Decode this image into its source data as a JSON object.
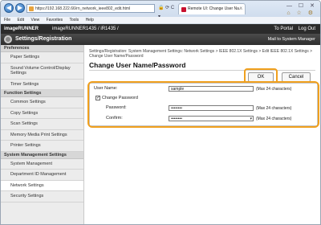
{
  "browser": {
    "back_glyph": "◀",
    "forward_glyph": "▶",
    "url": "https://192.168.222.66/rn_network_ieee802_edit.html",
    "addr_tools": "🔒 ⟳ C ▾",
    "tab_title": "Remote UI: Change User Na...",
    "tab_close": "×",
    "win_controls": "— ☐ ✕",
    "right_icons": "⌂ ☆ ⚙"
  },
  "menu": {
    "items": [
      "File",
      "Edit",
      "View",
      "Favorites",
      "Tools",
      "Help"
    ]
  },
  "header": {
    "brand": "imageRUNNER",
    "device": "imageRUNNER1435 / iR1435 /",
    "to_portal": "To Portal",
    "log_out": "Log Out",
    "section_title": "Settings/Registration",
    "mail_link": "Mail to System Manager"
  },
  "sidebar": {
    "preferences_head": "Preferences",
    "preferences": [
      "Paper Settings",
      "Sound Volume Control/Display Settings",
      "Timer Settings"
    ],
    "function_head": "Function Settings",
    "function": [
      "Common Settings",
      "Copy Settings",
      "Scan Settings",
      "Memory Media Print Settings",
      "Printer Settings"
    ],
    "system_head": "System Management Settings",
    "system": [
      "System Management",
      "Department ID Management",
      "Network Settings",
      "Security Settings"
    ]
  },
  "main": {
    "breadcrumb": "Settings/Registration: System Management Settings: Network Settings > IEEE 802.1X Settings > Edit IEEE 802.1X Settings > Change User Name/Password",
    "page_title": "Change User Name/Password",
    "ok_label": "OK",
    "cancel_label": "Cancel",
    "user_name_label": "User Name:",
    "user_name_value": "sample",
    "user_name_max": "(Max 24 characters)",
    "change_password_label": "Change Password",
    "change_password_checked": "✓",
    "password_label": "Password:",
    "password_value": "••••••••",
    "password_max": "(Max 24 characters)",
    "confirm_label": "Confirm:",
    "confirm_value": "••••••••",
    "confirm_max": "(Max 24 characters)"
  },
  "colors": {
    "highlight": "#f0a01e",
    "header_bg": "#2b2b2b"
  }
}
